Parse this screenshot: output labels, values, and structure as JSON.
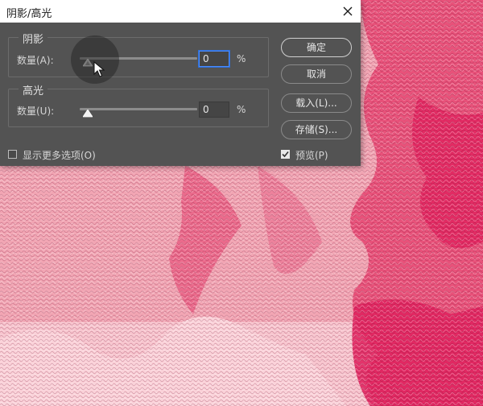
{
  "dialog": {
    "title": "阴影/高光",
    "shadows": {
      "legend": "阴影",
      "amount_label": "数量(A):",
      "amount_value": "0",
      "amount_percent": 0,
      "unit": "%"
    },
    "highlights": {
      "legend": "高光",
      "amount_label": "数量(U):",
      "amount_value": "0",
      "amount_percent": 0,
      "unit": "%"
    },
    "buttons": {
      "ok": "确定",
      "cancel": "取消",
      "load": "载入(L)...",
      "save": "存储(S)..."
    },
    "show_more": {
      "label": "显示更多选项(O)",
      "checked": false
    },
    "preview": {
      "label": "预览(P)",
      "checked": true
    }
  },
  "colors": {
    "dialog_bg": "#535353",
    "canvas_light": "#f2a6b4",
    "canvas_deep": "#e0245f",
    "focus_ring": "#4a8cff"
  }
}
